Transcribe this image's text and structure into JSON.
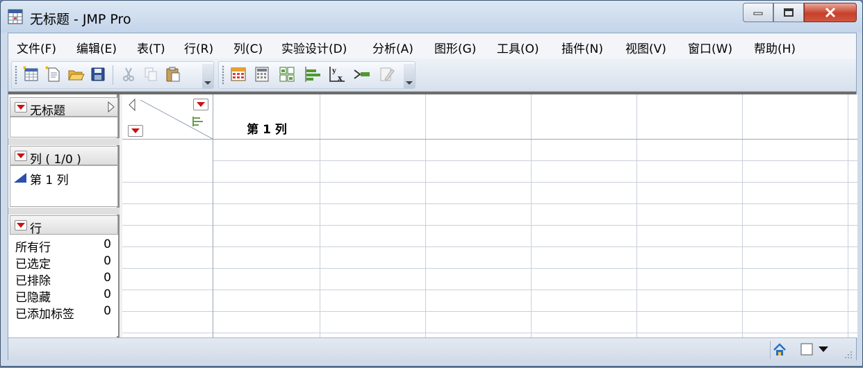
{
  "window": {
    "title": "无标题 - JMP Pro",
    "controls": [
      "minimize",
      "maximize",
      "close"
    ]
  },
  "menu": [
    {
      "label": "文件(F)"
    },
    {
      "label": "编辑(E)"
    },
    {
      "label": "表(T)"
    },
    {
      "label": "行(R)"
    },
    {
      "label": "列(C)"
    },
    {
      "label": "实验设计(D)"
    },
    {
      "label": "分析(A)"
    },
    {
      "label": "图形(G)"
    },
    {
      "label": "工具(O)"
    },
    {
      "label": "插件(N)"
    },
    {
      "label": "视图(V)"
    },
    {
      "label": "窗口(W)"
    },
    {
      "label": "帮助(H)"
    }
  ],
  "toolbar": {
    "file_group": [
      "new-data-table-icon",
      "new-script-icon",
      "open-folder-icon",
      "save-icon"
    ],
    "edit_group": [
      "cut-icon",
      "copy-icon",
      "paste-icon"
    ],
    "table_group": [
      "data-table-icon",
      "summary-icon",
      "tabulate-icon",
      "distribution-icon",
      "fit-y-by-x-icon",
      "fit-model-icon",
      "edit-script-icon"
    ]
  },
  "left_panel": {
    "table_name": "无标题",
    "columns_header": "列 ( 1/0 )",
    "columns": [
      {
        "name": "第 1 列",
        "type_icon": "continuous-icon"
      }
    ],
    "rows_header": "行",
    "row_stats": [
      {
        "label": "所有行",
        "value": "0"
      },
      {
        "label": "已选定",
        "value": "0"
      },
      {
        "label": "已排除",
        "value": "0"
      },
      {
        "label": "已隐藏",
        "value": "0"
      },
      {
        "label": "已添加标签",
        "value": "0"
      }
    ]
  },
  "grid": {
    "column_headers": [
      "第 1 列"
    ],
    "row_count": 0
  },
  "statusbar": {
    "icons": [
      "home-icon",
      "window-list-icon",
      "dropdown-icon"
    ]
  },
  "colors": {
    "hotspot_red": "#cc1111",
    "continuous_blue": "#2b4fae",
    "title_bar": "#cfdbea",
    "close_button": "#c7402b"
  }
}
